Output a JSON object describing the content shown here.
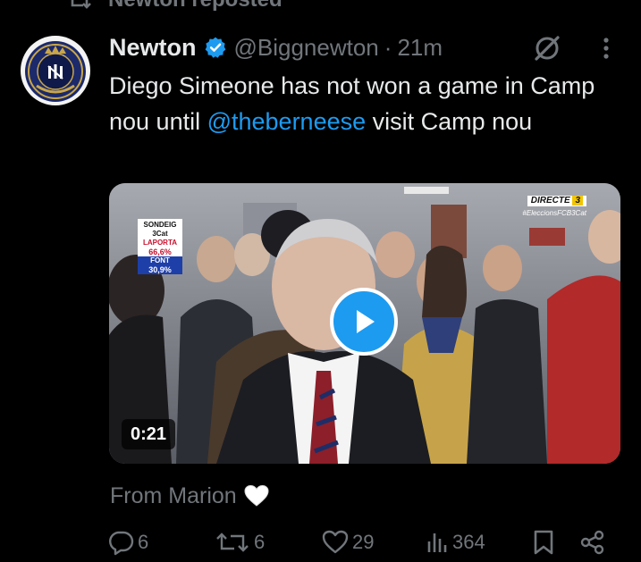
{
  "repost": {
    "label": "Newton reposted"
  },
  "tweet": {
    "author_name": "Newton",
    "handle": "@Biggnewton",
    "separator": "·",
    "time": "21m",
    "text_before": "Diego Simeone has not won a game  in Camp nou until ",
    "mention": "@theberneese",
    "text_after": " visit Camp nou"
  },
  "media": {
    "duration": "0:21",
    "poll": {
      "title_line1": "SONDEIG",
      "title_line2": "3Cat",
      "candidate1": "LAPORTA",
      "value1": "66,6%",
      "candidate2": "FONT",
      "value2": "30,9%"
    },
    "channel": {
      "badge": "DIRECTE",
      "badge_logo": "3",
      "hashtag": "#EleccionsFCB3Cat"
    }
  },
  "translation": {
    "label": "From Marion"
  },
  "actions": {
    "replies": "6",
    "reposts": "6",
    "likes": "29",
    "views": "364"
  },
  "colors": {
    "background": "#000000",
    "text": "#e7e9ea",
    "muted": "#71767b",
    "accent": "#1d9bf0"
  },
  "icons": {
    "repost": "repost-icon",
    "verified": "verified-badge-icon",
    "grok": "grok-icon",
    "more": "more-vertical-icon",
    "play": "play-icon",
    "heart_emoji": "white-heart-icon",
    "reply": "reply-icon",
    "like": "like-icon",
    "views": "views-icon",
    "bookmark": "bookmark-icon",
    "share": "share-icon"
  }
}
